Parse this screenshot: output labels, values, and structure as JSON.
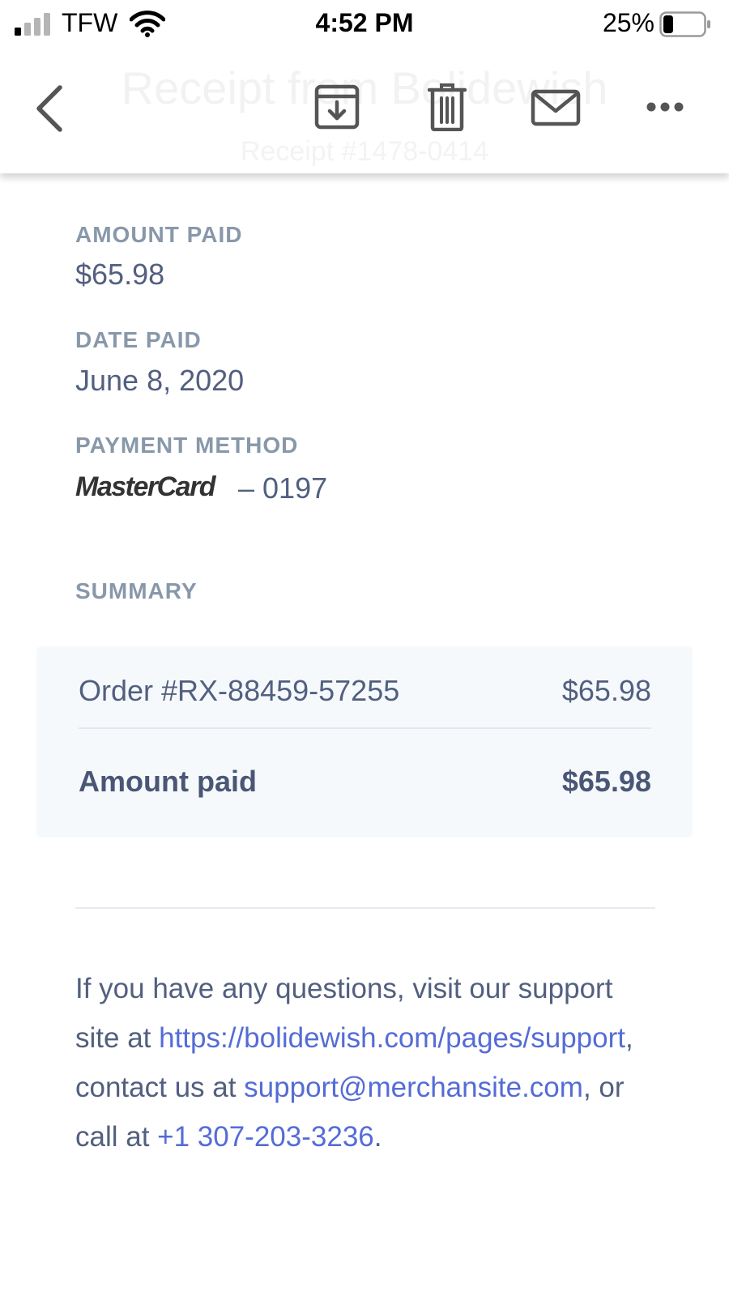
{
  "status_bar": {
    "carrier": "TFW",
    "time": "4:52 PM",
    "battery_percent": "25%",
    "battery_level": 0.25,
    "signal_bars": 1,
    "signal_bars_total": 4
  },
  "nav_bar": {
    "title": "Receipt from Bolidewish",
    "subtitle": "Receipt #1478-0414",
    "icons": [
      "chevron-left-icon",
      "archive-icon",
      "trash-icon",
      "mail-icon",
      "more-icon"
    ]
  },
  "receipt": {
    "amount_paid": {
      "label": "AMOUNT PAID",
      "value": "$65.98"
    },
    "date_paid": {
      "label": "DATE PAID",
      "value": "June 8, 2020"
    },
    "payment_method": {
      "label": "PAYMENT METHOD",
      "brand": "MasterCard",
      "last4": "– 0197"
    }
  },
  "summary": {
    "label": "SUMMARY",
    "order": {
      "label": "Order #RX-88459-57255",
      "amount": "$65.98"
    },
    "total": {
      "label": "Amount paid",
      "amount": "$65.98"
    }
  },
  "support": {
    "text1": "If you have any questions, visit our support site at ",
    "site_link": "https://bolidewish.com/pages/support",
    "text2": ", contact us at ",
    "email_link": "support@merchansite.com",
    "text3": ", or call at ",
    "phone_link": "+1 307-203-3236",
    "text4": "."
  },
  "colors": {
    "label": "#8898aa",
    "text": "#525f7f",
    "link": "#556cd6",
    "summary_bg": "#f6f9fc"
  }
}
